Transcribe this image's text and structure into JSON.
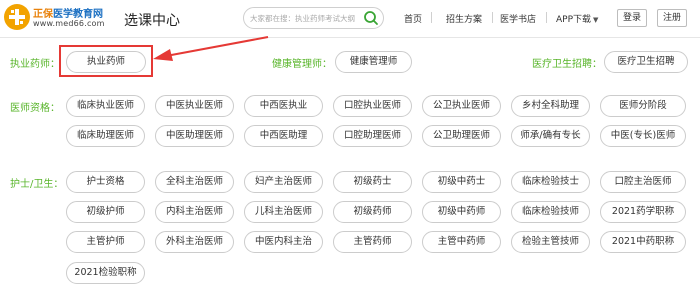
{
  "header": {
    "logo_brand": "正保",
    "logo_name": "医学教育网",
    "logo_url": "www.med66.com",
    "page_title": "选课中心",
    "search_placeholder": "大家都在搜：执业药师考试大纲",
    "nav": [
      "首页",
      "招生方案",
      "医学书店",
      "APP下载"
    ],
    "login": "登录",
    "register": "注册"
  },
  "sections": {
    "yaoshi": {
      "label": "执业药师：",
      "items": [
        "执业药师"
      ]
    },
    "jiankang": {
      "label": "健康管理师：",
      "items": [
        "健康管理师"
      ]
    },
    "zhaopin": {
      "label": "医疗卫生招聘：",
      "items": [
        "医疗卫生招聘"
      ]
    },
    "yishi": {
      "label": "医师资格：",
      "row1": [
        "临床执业医师",
        "中医执业医师",
        "中西医执业",
        "口腔执业医师",
        "公卫执业医师",
        "乡村全科助理",
        "医师分阶段"
      ],
      "row2": [
        "临床助理医师",
        "中医助理医师",
        "中西医助理",
        "口腔助理医师",
        "公卫助理医师",
        "师承/确有专长",
        "中医(专长)医师"
      ]
    },
    "hushi": {
      "label": "护士/卫生：",
      "row1": [
        "护士资格",
        "全科主治医师",
        "妇产主治医师",
        "初级药士",
        "初级中药士",
        "临床检验技士",
        "口腔主治医师"
      ],
      "row2": [
        "初级护师",
        "内科主治医师",
        "儿科主治医师",
        "初级药师",
        "初级中药师",
        "临床检验技师",
        "2021药学职称"
      ],
      "row3": [
        "主管护师",
        "外科主治医师",
        "中医内科主治",
        "主管药师",
        "主管中药师",
        "检验主管技师",
        "2021中药职称"
      ],
      "row4": [
        "2021检验职称"
      ]
    }
  },
  "colors": {
    "label_green": "#59b52b",
    "highlight_red": "#e53935",
    "logo_orange": "#f2a300",
    "logo_blue": "#1a6fc2"
  }
}
